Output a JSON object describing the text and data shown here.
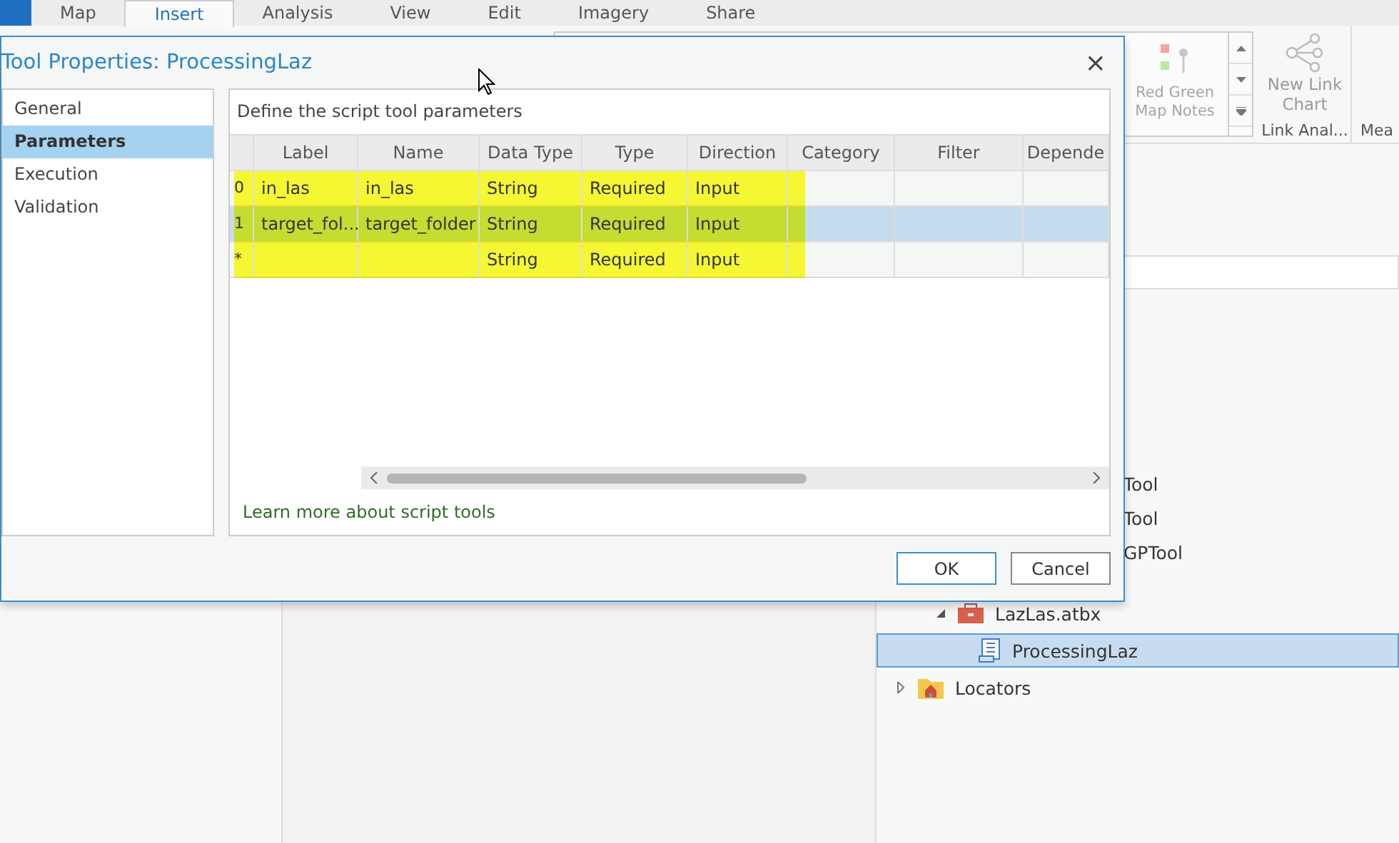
{
  "ribbon_tabs": [
    {
      "label": "Map",
      "selected": false
    },
    {
      "label": "Insert",
      "selected": true
    },
    {
      "label": "Analysis",
      "selected": false
    },
    {
      "label": "View",
      "selected": false
    },
    {
      "label": "Edit",
      "selected": false
    },
    {
      "label": "Imagery",
      "selected": false
    },
    {
      "label": "Share",
      "selected": false
    }
  ],
  "ribbon": {
    "gallery_item": "Red Green Map Notes",
    "link_chart": "New Link Chart",
    "group_label": "Link Anal...",
    "next_group_label": "Mea"
  },
  "catalog": {
    "partial_items": [
      "Tool",
      "Tool",
      "GPTool"
    ],
    "tree": [
      {
        "label": "LazLas.atbx",
        "kind": "toolbox",
        "expanded": true,
        "selected": false,
        "children": [
          {
            "label": "ProcessingLaz",
            "kind": "script",
            "selected": true
          }
        ]
      },
      {
        "label": "Locators",
        "kind": "folder",
        "expanded": false,
        "selected": false
      }
    ]
  },
  "dialog": {
    "title": "Tool Properties: ProcessingLaz",
    "close": "×",
    "nav": [
      {
        "label": "General",
        "selected": false
      },
      {
        "label": "Parameters",
        "selected": true
      },
      {
        "label": "Execution",
        "selected": false
      },
      {
        "label": "Validation",
        "selected": false
      }
    ],
    "caption": "Define the script tool parameters",
    "table": {
      "columns": [
        "Label",
        "Name",
        "Data Type",
        "Type",
        "Direction",
        "Category",
        "Filter",
        "Depende"
      ],
      "rows": [
        {
          "index": "0",
          "cells": [
            "in_las",
            "in_las",
            "String",
            "Required",
            "Input",
            "",
            "",
            ""
          ],
          "selected": false
        },
        {
          "index": "1",
          "cells": [
            "target_fol...",
            "target_folder",
            "String",
            "Required",
            "Input",
            "",
            "",
            ""
          ],
          "selected": true
        },
        {
          "index": "*",
          "cells": [
            "",
            "",
            "String",
            "Required",
            "Input",
            "",
            "",
            ""
          ],
          "selected": false
        }
      ]
    },
    "link": "Learn more about script tools",
    "buttons": [
      {
        "label": "OK",
        "kind": "primary"
      },
      {
        "label": "Cancel",
        "kind": "secondary"
      }
    ]
  }
}
